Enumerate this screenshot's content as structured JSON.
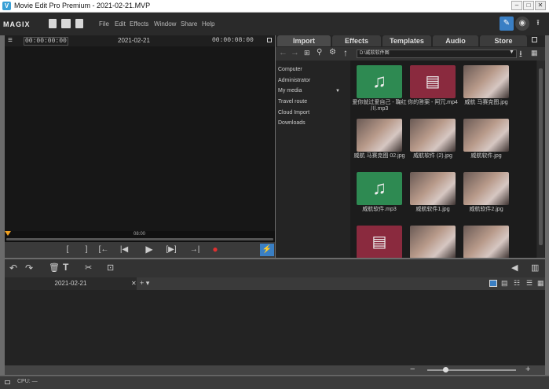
{
  "window": {
    "title": "Movie Edit Pro Premium - 2021-02-21.MVP",
    "app_icon": "V"
  },
  "menubar": {
    "logo": "MAGIX",
    "items": [
      "File",
      "Edit",
      "Effects",
      "Window",
      "Share",
      "Help"
    ]
  },
  "preview": {
    "timecode_left": "00:00:00:00",
    "date": "2021-02-21",
    "timecode_right": "00:00:08:00",
    "ruler_label": "08:00"
  },
  "transport": {
    "buttons": [
      "[",
      "]",
      "[←",
      "|◀",
      "▶",
      "[▶]",
      "→|",
      "●"
    ]
  },
  "media": {
    "tabs": [
      "Import",
      "Effects",
      "Templates",
      "Audio",
      "Store"
    ],
    "path": "D:\\威软软件图",
    "tree": [
      "Computer",
      "Administrator",
      "My media",
      "Travel route",
      "Cloud Import",
      "Downloads"
    ],
    "items": [
      {
        "kind": "audio",
        "caption": "爱你就过爱自己 - 鞠红川.mp3"
      },
      {
        "kind": "video",
        "caption": "你的答案 - 阿冗.mp4"
      },
      {
        "kind": "photo",
        "caption": "威航 马赛克图.jpg"
      },
      {
        "kind": "photo",
        "caption": "威航 马赛克图 02.jpg"
      },
      {
        "kind": "photo",
        "caption": "威航软件 (2).jpg"
      },
      {
        "kind": "photo",
        "caption": "威航软件.jpg"
      },
      {
        "kind": "audio",
        "caption": "威航软件.mp3"
      },
      {
        "kind": "photo",
        "caption": "威航软件1.jpg"
      },
      {
        "kind": "photo",
        "caption": "威航软件2.jpg"
      },
      {
        "kind": "video",
        "caption": ""
      },
      {
        "kind": "photo",
        "caption": ""
      },
      {
        "kind": "photo",
        "caption": ""
      }
    ]
  },
  "arranger": {
    "tab_label": "2021-02-21",
    "add_label": "+ ▾"
  },
  "status": {
    "text": "CPU: —"
  },
  "colors": {
    "audio": "#2e8a52",
    "video": "#8a2a3e",
    "photo": "#6a5a55",
    "accent": "#3a7fc4",
    "record": "#e03030",
    "marker": "#f0a020"
  }
}
